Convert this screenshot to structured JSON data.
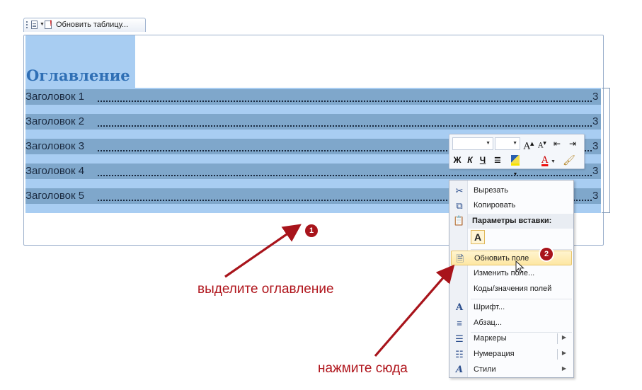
{
  "field_toolbar": {
    "update_table_label": "Обновить таблицу..."
  },
  "document": {
    "toc_title": "Оглавление",
    "entries": [
      {
        "text": "Заголовок 1",
        "page": "3"
      },
      {
        "text": "Заголовок 2",
        "page": "3"
      },
      {
        "text": "Заголовок 3",
        "page": "3"
      },
      {
        "text": "Заголовок 4",
        "page": "3"
      },
      {
        "text": "Заголовок 5",
        "page": "3"
      }
    ]
  },
  "mini_toolbar": {
    "font_name": "",
    "font_size": "",
    "grow_font": "A",
    "shrink_font": "A",
    "bold": "Ж",
    "italic": "К",
    "underline": "Ч",
    "font_color": "A"
  },
  "context_menu": {
    "cut": "Вырезать",
    "copy": "Копировать",
    "paste_options_header": "Параметры вставки:",
    "paste_keep_text": "A",
    "update_field": "Обновить поле",
    "edit_field": "Изменить поле...",
    "toggle_field_codes": "Коды/значения полей",
    "font": "Шрифт...",
    "paragraph": "Абзац...",
    "bullets": "Маркеры",
    "numbering": "Нумерация",
    "styles": "Стили"
  },
  "annotations": {
    "step1_number": "1",
    "step1_text": "выделите оглавление",
    "step2_number": "2",
    "step2_text": "нажмите сюда"
  },
  "colors": {
    "selection_light": "#a8cdf2",
    "selection_dark": "#7fa7cb",
    "toc_title": "#2f6fb5",
    "annotation_red": "#b0151c",
    "menu_highlight": "#fde7a3"
  }
}
